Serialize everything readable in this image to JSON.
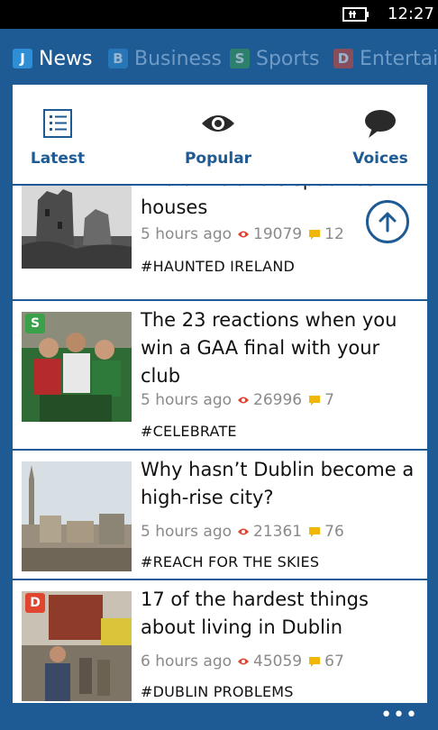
{
  "status": {
    "time": "12:27",
    "battery_icon": "battery-charging-icon"
  },
  "pivot": [
    {
      "badge": "J",
      "label": "News",
      "badge_color": "#2f8fd6",
      "active": true
    },
    {
      "badge": "B",
      "label": "Business",
      "badge_color": "#2f8fd6",
      "active": false
    },
    {
      "badge": "S",
      "label": "Sports",
      "badge_color": "#3aa04a",
      "active": false
    },
    {
      "badge": "D",
      "label": "Entertain",
      "badge_color": "#e0452f",
      "active": false
    }
  ],
  "filters": [
    {
      "label": "Latest",
      "icon": "list-icon"
    },
    {
      "label": "Popular",
      "icon": "eye-icon"
    },
    {
      "label": "Voices",
      "icon": "speech-bubble-icon"
    }
  ],
  "articles": [
    {
      "headline": "two of Ireland’s spookiest houses",
      "time": "5 hours ago",
      "views": "19079",
      "comments": "12",
      "tag": "#HAUNTED IRELAND",
      "badge": ""
    },
    {
      "headline": "The 23 reactions when you win a GAA final with your club",
      "time": "5 hours ago",
      "views": "26996",
      "comments": "7",
      "tag": "#CELEBRATE",
      "badge": "S",
      "badge_color": "#3aa04a"
    },
    {
      "headline": "Why hasn’t Dublin become a high-rise city?",
      "time": "5 hours ago",
      "views": "21361",
      "comments": "76",
      "tag": "#REACH FOR THE SKIES",
      "badge": ""
    },
    {
      "headline": "17 of the hardest things about living in Dublin",
      "time": "6 hours ago",
      "views": "45059",
      "comments": "67",
      "tag": "#DUBLIN PROBLEMS",
      "badge": "D",
      "badge_color": "#e0452f"
    }
  ],
  "colors": {
    "accent": "#1e5a94",
    "view_icon": "#e0452f",
    "comment_icon": "#f2b705"
  },
  "app_bar": {
    "more": "•••"
  }
}
